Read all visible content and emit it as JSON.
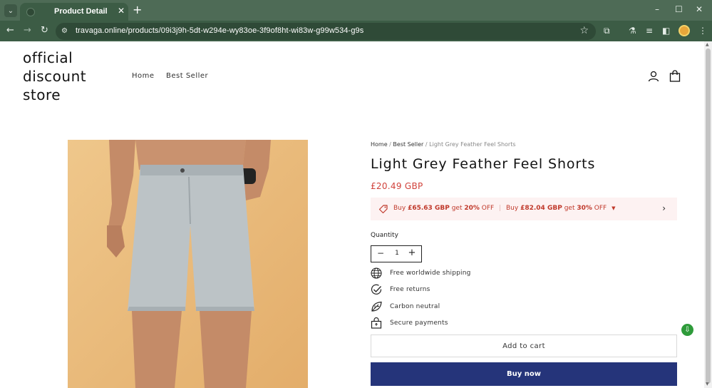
{
  "browser": {
    "tab_title": "Product Detail",
    "tab_close": "✕",
    "new_tab": "+",
    "url": "travaga.online/products/09i3j9h-5dt-w294e-wy83oe-3f9of8ht-wi83w-g99w534-g9s",
    "window_controls": [
      "–",
      "☐",
      "✕"
    ]
  },
  "store": {
    "logo": "official discount store",
    "nav": [
      "Home",
      "Best Seller"
    ]
  },
  "breadcrumb": {
    "home": "Home",
    "sep1": "/",
    "category": "Best Seller",
    "sep2": "/",
    "current": "Light Grey Feather Feel Shorts"
  },
  "product": {
    "title": "Light Grey Feather Feel Shorts",
    "price": "£20.49 GBP"
  },
  "offers": {
    "offer1_prefix": "Buy",
    "offer1_amount": "£65.63 GBP",
    "offer1_mid": "get",
    "offer1_discount": "20%",
    "offer1_suffix": "OFF",
    "offer2_prefix": "Buy",
    "offer2_amount": "£82.04 GBP",
    "offer2_mid": "get",
    "offer2_discount": "30%",
    "offer2_suffix": "OFF"
  },
  "quantity": {
    "label": "Quantity",
    "value": "1",
    "minus": "−",
    "plus": "+"
  },
  "features": [
    {
      "icon": "globe-icon",
      "label": "Free worldwide shipping"
    },
    {
      "icon": "check-circle-icon",
      "label": "Free returns"
    },
    {
      "icon": "leaf-icon",
      "label": "Carbon neutral"
    },
    {
      "icon": "lock-icon",
      "label": "Secure payments"
    }
  ],
  "actions": {
    "add_to_cart": "Add to cart",
    "buy_now": "Buy now"
  },
  "colors": {
    "buy_now_bg": "#25347a",
    "price": "#d1423b",
    "offer_bg": "#fdf2f2",
    "browser_frame": "#4e6b56"
  }
}
